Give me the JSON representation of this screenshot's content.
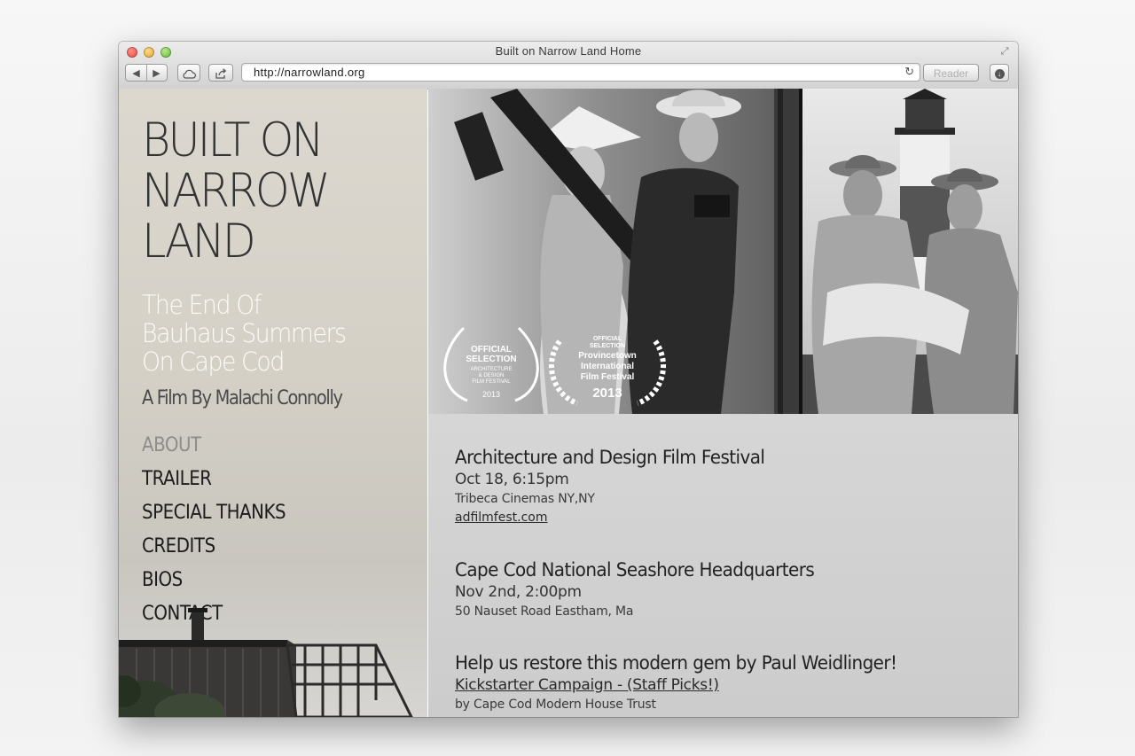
{
  "browser": {
    "window_title": "Built on Narrow Land Home",
    "url": "http://narrowland.org",
    "reader_label": "Reader",
    "back_icon": "◀",
    "forward_icon": "▶",
    "reload_icon": "↻"
  },
  "site": {
    "title_lines": [
      "BUILT ON",
      "NARROW",
      "LAND"
    ],
    "subtitle_lines": [
      "The End Of",
      "Bauhaus Summers",
      "On Cape Cod"
    ],
    "byline": "A Film By Malachi Connolly",
    "nav": [
      {
        "label": "ABOUT",
        "active": true
      },
      {
        "label": "TRAILER",
        "active": false
      },
      {
        "label": "SPECIAL THANKS",
        "active": false
      },
      {
        "label": "CREDITS",
        "active": false
      },
      {
        "label": "BIOS",
        "active": false
      },
      {
        "label": "CONTACT",
        "active": false
      }
    ]
  },
  "laurels": {
    "first": {
      "lines": [
        "OFFICIAL",
        "SELECTION",
        "ARCHITECTURE",
        "& DESIGN",
        "FILM FESTIVAL"
      ],
      "year": "2013"
    },
    "second": {
      "lines": [
        "OFFICIAL",
        "SELECTION",
        "Provincetown",
        "International",
        "Film Festival"
      ],
      "year": "2013"
    }
  },
  "events": [
    {
      "title": "Architecture and Design Film Festival",
      "when": "Oct 18, 6:15pm",
      "where": "Tribeca Cinemas NY,NY",
      "link": "adfilmfest.com"
    },
    {
      "title": "Cape Cod National Seashore Headquarters",
      "when": "Nov 2nd, 2:00pm",
      "where": "50 Nauset Road Eastham, Ma"
    },
    {
      "title": "Help us restore this modern gem by Paul Weidlinger!",
      "link": "Kickstarter Campaign - (Staff Picks!)",
      "where": "by Cape Cod Modern House Trust"
    }
  ]
}
